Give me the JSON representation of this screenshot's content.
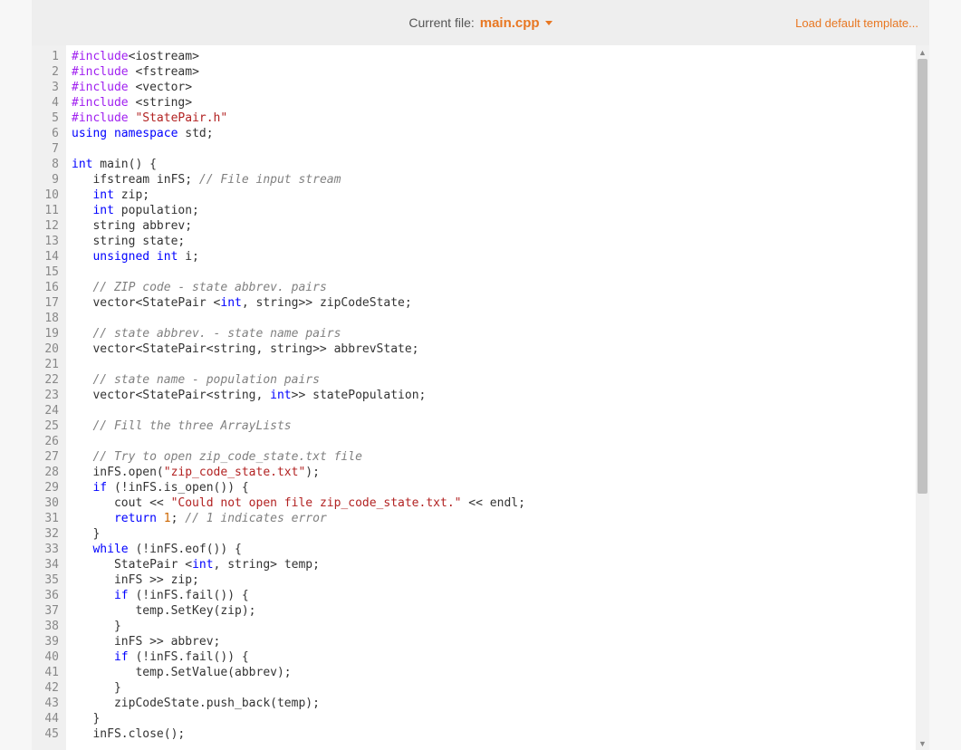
{
  "header": {
    "current_file_label": "Current file:",
    "current_file_name": "main.cpp",
    "load_template": "Load default template..."
  },
  "code": {
    "lines": [
      [
        [
          "include",
          "#include"
        ],
        [
          "plain",
          "<iostream>"
        ]
      ],
      [
        [
          "include",
          "#include"
        ],
        [
          "plain",
          " "
        ],
        [
          "plain",
          "<fstream>"
        ]
      ],
      [
        [
          "include",
          "#include"
        ],
        [
          "plain",
          " "
        ],
        [
          "plain",
          "<vector>"
        ]
      ],
      [
        [
          "include",
          "#include"
        ],
        [
          "plain",
          " "
        ],
        [
          "plain",
          "<string>"
        ]
      ],
      [
        [
          "include",
          "#include"
        ],
        [
          "plain",
          " "
        ],
        [
          "string",
          "\"StatePair.h\""
        ]
      ],
      [
        [
          "keyword",
          "using"
        ],
        [
          "plain",
          " "
        ],
        [
          "keyword",
          "namespace"
        ],
        [
          "plain",
          " std;"
        ]
      ],
      [],
      [
        [
          "type",
          "int"
        ],
        [
          "plain",
          " main() {"
        ]
      ],
      [
        [
          "plain",
          "   ifstream inFS; "
        ],
        [
          "comment",
          "// File input stream"
        ]
      ],
      [
        [
          "plain",
          "   "
        ],
        [
          "type",
          "int"
        ],
        [
          "plain",
          " zip;"
        ]
      ],
      [
        [
          "plain",
          "   "
        ],
        [
          "type",
          "int"
        ],
        [
          "plain",
          " population;"
        ]
      ],
      [
        [
          "plain",
          "   string abbrev;"
        ]
      ],
      [
        [
          "plain",
          "   string state;"
        ]
      ],
      [
        [
          "plain",
          "   "
        ],
        [
          "type",
          "unsigned int"
        ],
        [
          "plain",
          " i;"
        ]
      ],
      [],
      [
        [
          "plain",
          "   "
        ],
        [
          "comment",
          "// ZIP code - state abbrev. pairs"
        ]
      ],
      [
        [
          "plain",
          "   vector<StatePair <"
        ],
        [
          "type",
          "int"
        ],
        [
          "plain",
          ", string>> zipCodeState;"
        ]
      ],
      [],
      [
        [
          "plain",
          "   "
        ],
        [
          "comment",
          "// state abbrev. - state name pairs"
        ]
      ],
      [
        [
          "plain",
          "   vector<StatePair<string, string>> abbrevState;"
        ]
      ],
      [],
      [
        [
          "plain",
          "   "
        ],
        [
          "comment",
          "// state name - population pairs"
        ]
      ],
      [
        [
          "plain",
          "   vector<StatePair<string, "
        ],
        [
          "type",
          "int"
        ],
        [
          "plain",
          ">> statePopulation;"
        ]
      ],
      [],
      [
        [
          "plain",
          "   "
        ],
        [
          "comment",
          "// Fill the three ArrayLists"
        ]
      ],
      [],
      [
        [
          "plain",
          "   "
        ],
        [
          "comment",
          "// Try to open zip_code_state.txt file"
        ]
      ],
      [
        [
          "plain",
          "   inFS.open("
        ],
        [
          "string",
          "\"zip_code_state.txt\""
        ],
        [
          "plain",
          ");"
        ]
      ],
      [
        [
          "plain",
          "   "
        ],
        [
          "keyword",
          "if"
        ],
        [
          "plain",
          " (!inFS.is_open()) {"
        ]
      ],
      [
        [
          "plain",
          "      cout << "
        ],
        [
          "string",
          "\"Could not open file zip_code_state.txt.\""
        ],
        [
          "plain",
          " << endl;"
        ]
      ],
      [
        [
          "plain",
          "      "
        ],
        [
          "keyword",
          "return"
        ],
        [
          "plain",
          " "
        ],
        [
          "number",
          "1"
        ],
        [
          "plain",
          "; "
        ],
        [
          "comment",
          "// 1 indicates error"
        ]
      ],
      [
        [
          "plain",
          "   }"
        ]
      ],
      [
        [
          "plain",
          "   "
        ],
        [
          "keyword",
          "while"
        ],
        [
          "plain",
          " (!inFS.eof()) {"
        ]
      ],
      [
        [
          "plain",
          "      StatePair <"
        ],
        [
          "type",
          "int"
        ],
        [
          "plain",
          ", string> temp;"
        ]
      ],
      [
        [
          "plain",
          "      inFS >> zip;"
        ]
      ],
      [
        [
          "plain",
          "      "
        ],
        [
          "keyword",
          "if"
        ],
        [
          "plain",
          " (!inFS.fail()) {"
        ]
      ],
      [
        [
          "plain",
          "         temp.SetKey(zip);"
        ]
      ],
      [
        [
          "plain",
          "      }"
        ]
      ],
      [
        [
          "plain",
          "      inFS >> abbrev;"
        ]
      ],
      [
        [
          "plain",
          "      "
        ],
        [
          "keyword",
          "if"
        ],
        [
          "plain",
          " (!inFS.fail()) {"
        ]
      ],
      [
        [
          "plain",
          "         temp.SetValue(abbrev);"
        ]
      ],
      [
        [
          "plain",
          "      }"
        ]
      ],
      [
        [
          "plain",
          "      zipCodeState.push_back(temp);"
        ]
      ],
      [
        [
          "plain",
          "   }"
        ]
      ],
      [
        [
          "plain",
          "   inFS.close();"
        ]
      ]
    ]
  }
}
